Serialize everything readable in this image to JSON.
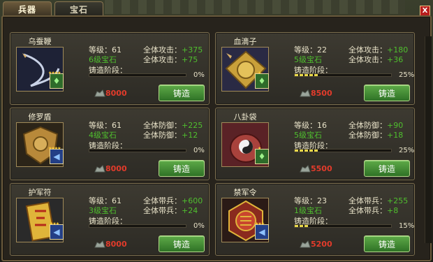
{
  "tabs": [
    {
      "label": "兵器",
      "active": true
    },
    {
      "label": "宝石",
      "active": false
    }
  ],
  "close_label": "X",
  "items": [
    {
      "name": "乌蚕鞭",
      "level": "等级：61",
      "gem": "6级宝石",
      "stat1_key": "全体攻击：",
      "stat1_val": "+375",
      "stat2_key": "全体攻击：",
      "stat2_val": "+75",
      "stage_label": "铸造阶段：",
      "progress": 0,
      "pct": "0%",
      "cost": "8000",
      "forge": "铸造",
      "gem_color": "green",
      "stars": "★★★★",
      "art": "whip-icon"
    },
    {
      "name": "血滴子",
      "level": "等级：22",
      "gem": "5级宝石",
      "stat1_key": "全体攻击：",
      "stat1_val": "+180",
      "stat2_key": "全体攻击：",
      "stat2_val": "+36",
      "stage_label": "铸造阶段：",
      "progress": 25,
      "pct": "25%",
      "cost": "8500",
      "forge": "铸造",
      "gem_color": "green",
      "stars": "★",
      "art": "blood-drop-icon"
    },
    {
      "name": "修罗盾",
      "level": "等级：61",
      "gem": "4级宝石",
      "stat1_key": "全体防御：",
      "stat1_val": "+225",
      "stat2_key": "全体防御：",
      "stat2_val": "+12",
      "stage_label": "铸造阶段：",
      "progress": 0,
      "pct": "0%",
      "cost": "8000",
      "forge": "铸造",
      "gem_color": "blue",
      "stars": "★★★★",
      "art": "shield-icon"
    },
    {
      "name": "八卦袋",
      "level": "等级：16",
      "gem": "5级宝石",
      "stat1_key": "全体防御：",
      "stat1_val": "+90",
      "stat2_key": "全体防御：",
      "stat2_val": "+18",
      "stage_label": "铸造阶段：",
      "progress": 25,
      "pct": "25%",
      "cost": "5500",
      "forge": "铸造",
      "gem_color": "green",
      "stars": "★",
      "art": "bagua-bag-icon"
    },
    {
      "name": "护军符",
      "level": "等级：61",
      "gem": "3级宝石",
      "stat1_key": "全体带兵：",
      "stat1_val": "+600",
      "stat2_key": "全体带兵：",
      "stat2_val": "+24",
      "stage_label": "铸造阶段：",
      "progress": 0,
      "pct": "0%",
      "cost": "8000",
      "forge": "铸造",
      "gem_color": "blue",
      "stars": "★★★",
      "art": "talisman-icon"
    },
    {
      "name": "禁军令",
      "level": "等级：23",
      "gem": "1级宝石",
      "stat1_key": "全体带兵：",
      "stat1_val": "+255",
      "stat2_key": "全体带兵：",
      "stat2_val": "+8",
      "stage_label": "铸造阶段：",
      "progress": 15,
      "pct": "15%",
      "cost": "5200",
      "forge": "铸造",
      "gem_color": "blue",
      "stars": "★★★",
      "art": "command-token-icon"
    }
  ]
}
